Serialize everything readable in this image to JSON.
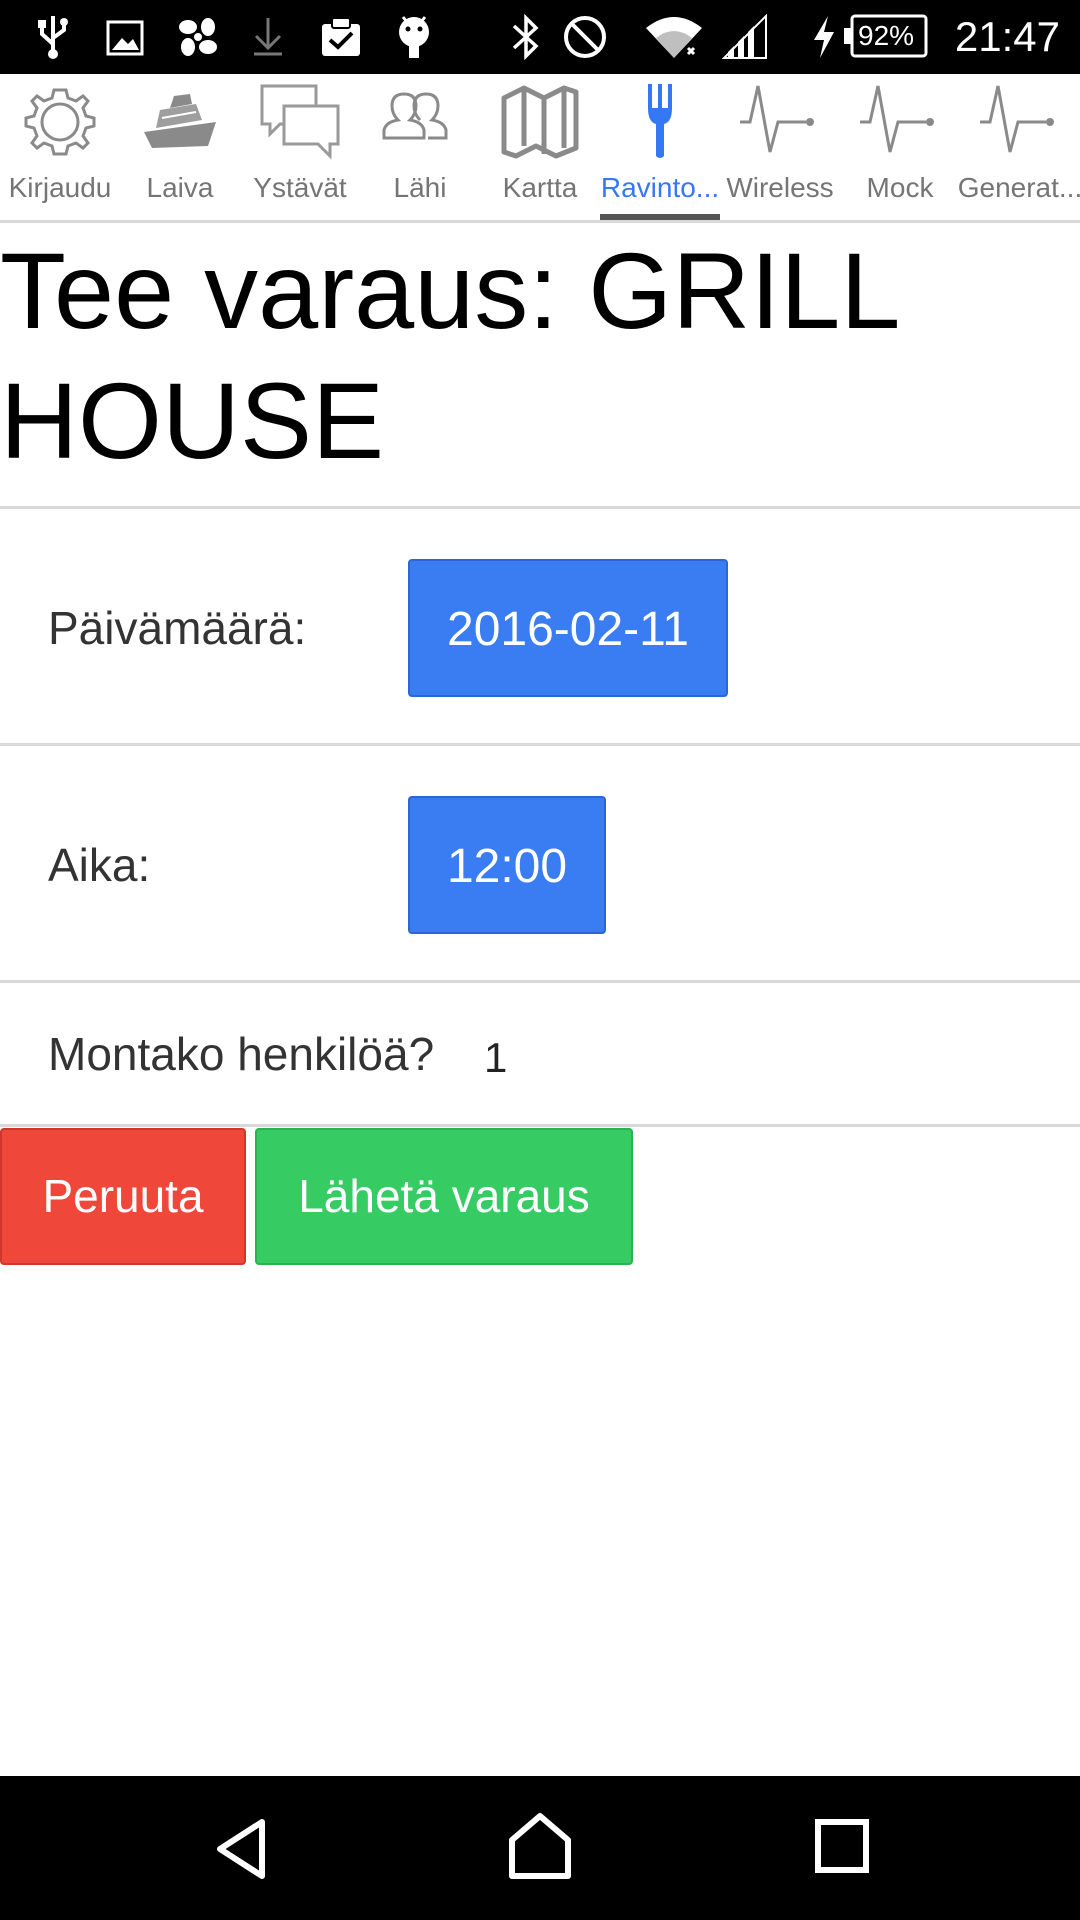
{
  "status_bar": {
    "battery_text": "92%",
    "time": "21:47",
    "icons": [
      "usb-icon",
      "image-icon",
      "pinwheel-icon",
      "download-icon",
      "clipboard-check-icon",
      "android-icon",
      "bluetooth-icon",
      "do-not-disturb-icon",
      "wifi-icon",
      "signal-icon",
      "charging-icon",
      "battery-icon"
    ]
  },
  "tabs": [
    {
      "label": "Kirjaudu",
      "icon": "gear-icon",
      "active": false
    },
    {
      "label": "Laiva",
      "icon": "ship-icon",
      "active": false
    },
    {
      "label": "Ystävät",
      "icon": "chat-icon",
      "active": false
    },
    {
      "label": "Lähi",
      "icon": "people-icon",
      "active": false
    },
    {
      "label": "Kartta",
      "icon": "map-icon",
      "active": false
    },
    {
      "label": "Ravinto...",
      "icon": "fork-icon",
      "active": true
    },
    {
      "label": "Wireless",
      "icon": "pulse-icon",
      "active": false
    },
    {
      "label": "Mock",
      "icon": "pulse-icon",
      "active": false
    },
    {
      "label": "Generat...",
      "icon": "pulse-icon",
      "active": false
    }
  ],
  "page": {
    "title": "Tee varaus: GRILL HOUSE",
    "date_label": "Päivämäärä:",
    "date_value": "2016-02-11",
    "time_label": "Aika:",
    "time_value": "12:00",
    "count_label": "Montako henkilöä?",
    "count_value": "1",
    "cancel_label": "Peruuta",
    "submit_label": "Lähetä varaus"
  },
  "colors": {
    "accent": "#3478f6",
    "picker": "#3a7cf1",
    "cancel": "#f0473b",
    "submit": "#37cc63"
  },
  "nav_bar": {
    "icons": [
      "back-icon",
      "home-icon",
      "recents-icon"
    ]
  }
}
